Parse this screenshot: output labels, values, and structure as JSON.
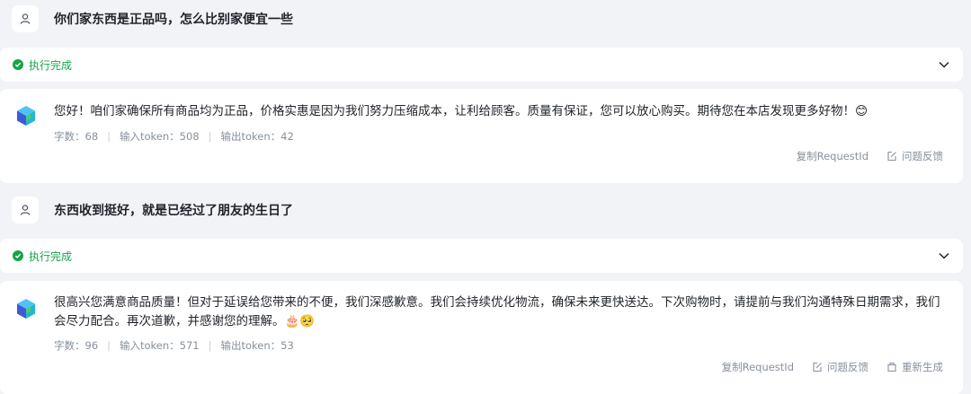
{
  "turns": [
    {
      "user_message": "你们家东西是正品吗，怎么比别家便宜一些",
      "status": "执行完成",
      "answer": "您好！咱们家确保所有商品均为正品，价格实惠是因为我们努力压缩成本，让利给顾客。质量有保证，您可以放心购买。期待您在本店发现更多好物！😊",
      "meta": {
        "chars": "字数：68",
        "input_tokens": "输入token：508",
        "output_tokens": "输出token：42"
      },
      "actions": {
        "copy": "复制RequestId",
        "feedback": "问题反馈"
      }
    },
    {
      "user_message": "东西收到挺好，就是已经过了朋友的生日了",
      "status": "执行完成",
      "answer": "很高兴您满意商品质量！但对于延误给您带来的不便，我们深感歉意。我们会持续优化物流，确保未来更快送达。下次购物时，请提前与我们沟通特殊日期需求，我们会尽力配合。再次道歉，并感谢您的理解。🎂🥺",
      "meta": {
        "chars": "字数：96",
        "input_tokens": "输入token：571",
        "output_tokens": "输出token：53"
      },
      "actions": {
        "copy": "复制RequestId",
        "feedback": "问题反馈",
        "regenerate": "重新生成"
      }
    }
  ],
  "colors": {
    "success": "#16a34a",
    "muted": "#86909c",
    "background": "#f2f3f6"
  },
  "icons": [
    "user-icon",
    "check-circle-icon",
    "chevron-down-icon",
    "bot-cube-icon",
    "edit-icon",
    "regenerate-icon"
  ]
}
